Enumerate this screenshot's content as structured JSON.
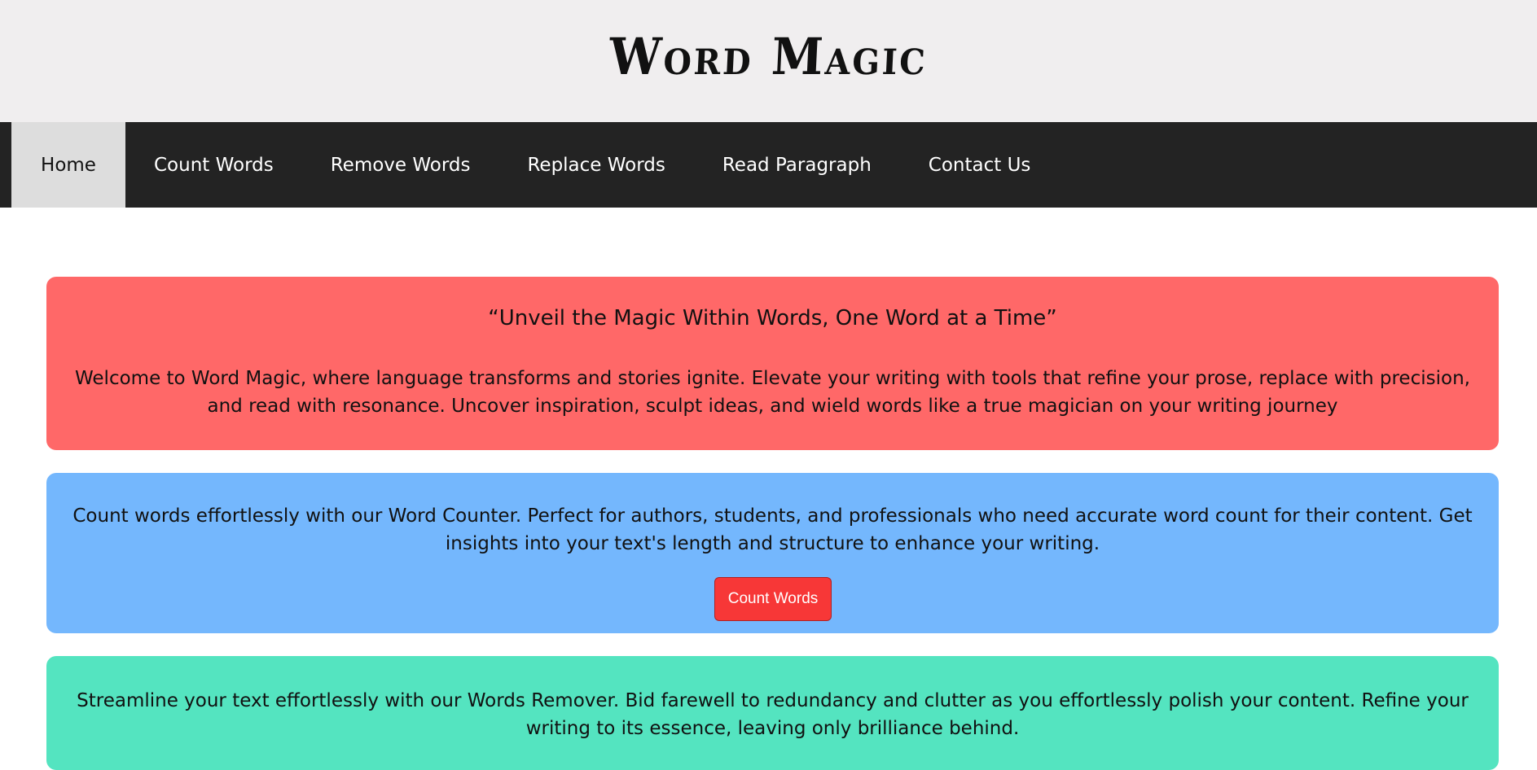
{
  "header": {
    "logo_text": "Word Magic"
  },
  "nav": {
    "items": [
      {
        "label": "Home",
        "active": true
      },
      {
        "label": "Count Words"
      },
      {
        "label": "Remove Words"
      },
      {
        "label": "Replace Words"
      },
      {
        "label": "Read Paragraph"
      },
      {
        "label": "Contact Us"
      }
    ]
  },
  "hero": {
    "tagline": "“Unveil the Magic Within Words, One Word at a Time”",
    "text": "Welcome to Word Magic, where language transforms and stories ignite. Elevate your writing with tools that refine your prose, replace with precision, and read with resonance. Uncover inspiration, sculpt ideas, and wield words like a true magician on your writing journey"
  },
  "count_section": {
    "text": "Count words effortlessly with our Word Counter. Perfect for authors, students, and professionals who need accurate word count for their content. Get insights into your text's length and structure to enhance your writing.",
    "button_label": "Count Words"
  },
  "remove_section": {
    "text": "Streamline your text effortlessly with our Words Remover. Bid farewell to redundancy and clutter as you effortlessly polish your content. Refine your writing to its essence, leaving only brilliance behind."
  },
  "colors": {
    "header_bg": "#f0eeef",
    "nav_bg": "#232323",
    "nav_active_bg": "#dddddd",
    "hero_bg": "#ff6868",
    "count_bg": "#74b7fd",
    "remove_bg": "#54e4c0",
    "button_bg": "#f73737"
  }
}
